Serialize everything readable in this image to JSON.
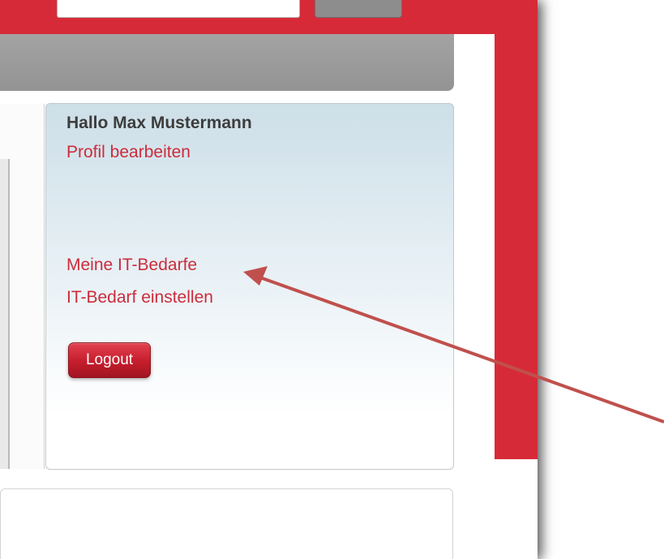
{
  "user_panel": {
    "greeting": "Hallo Max Mustermann",
    "profile_link": "Profil bearbeiten",
    "my_needs_link": "Meine IT-Bedarfe",
    "post_need_link": "IT-Bedarf einstellen",
    "logout_label": "Logout"
  },
  "colors": {
    "accent_red": "#d72a38",
    "link_red": "#cc2c3b",
    "nav_gray": "#9c9b9b",
    "annotation_arrow": "#c0504d"
  }
}
